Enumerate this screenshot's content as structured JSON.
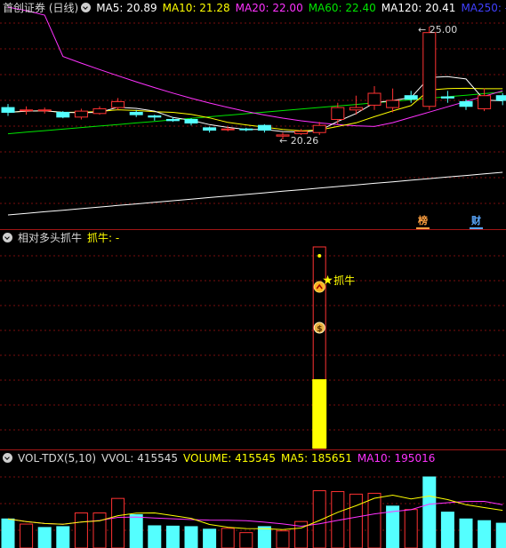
{
  "colors": {
    "up": "#ff3232",
    "down": "#54ffff",
    "ma5": "#ffffff",
    "ma10": "#ffff00",
    "ma20": "#ff32ff",
    "ma60": "#00e600",
    "ma120": "#ffffff",
    "ma250": "#4040ff",
    "grid": "#7a0e0e",
    "label": "#d8d8d8",
    "yellow": "#ffff00",
    "cyan": "#54ffff"
  },
  "main": {
    "title": "首创证券 (日线)",
    "ma": [
      {
        "label": "MA5: 20.89",
        "color": "#ffffff"
      },
      {
        "label": "MA10: 21.28",
        "color": "#ffff00"
      },
      {
        "label": "MA20: 22.00",
        "color": "#ff32ff"
      },
      {
        "label": "MA60: 22.40",
        "color": "#00e600"
      },
      {
        "label": "MA120: 20.41",
        "color": "#ffffff"
      },
      {
        "label": "MA250: -",
        "color": "#4040ff"
      }
    ],
    "high_label": "25.00",
    "low_label": "20.26",
    "tags": [
      {
        "text": "榜",
        "color": "#ffa040"
      },
      {
        "text": "财",
        "color": "#5aa8ff"
      }
    ]
  },
  "indicator": {
    "title": "相对多头抓牛",
    "signal_label": "抓牛: -",
    "star_label": "抓牛"
  },
  "volume": {
    "title": "VOL-TDX(5,10)",
    "vvol": "VVOL: 415545",
    "volume": "VOLUME: 415545",
    "ma5": "MA5: 185651",
    "ma10": "MA10: 195016"
  },
  "chart_data": {
    "type": "candlestick",
    "candles": [
      {
        "o": 21.6,
        "c": 21.4,
        "h": 21.75,
        "l": 21.25,
        "up": false
      },
      {
        "o": 21.5,
        "c": 21.5,
        "h": 21.65,
        "l": 21.3,
        "up": true
      },
      {
        "o": 21.5,
        "c": 21.5,
        "h": 21.6,
        "l": 21.35,
        "up": true
      },
      {
        "o": 21.4,
        "c": 21.2,
        "h": 21.45,
        "l": 21.15,
        "up": false
      },
      {
        "o": 21.2,
        "c": 21.45,
        "h": 21.55,
        "l": 21.1,
        "up": true
      },
      {
        "o": 21.35,
        "c": 21.55,
        "h": 21.65,
        "l": 21.3,
        "up": true
      },
      {
        "o": 21.6,
        "c": 21.85,
        "h": 22.0,
        "l": 21.5,
        "up": true
      },
      {
        "o": 21.4,
        "c": 21.3,
        "h": 21.5,
        "l": 21.2,
        "up": false
      },
      {
        "o": 21.25,
        "c": 21.2,
        "h": 21.3,
        "l": 21.05,
        "up": false
      },
      {
        "o": 21.1,
        "c": 21.05,
        "h": 21.2,
        "l": 21.0,
        "up": false
      },
      {
        "o": 21.1,
        "c": 20.95,
        "h": 21.15,
        "l": 20.85,
        "up": false
      },
      {
        "o": 20.75,
        "c": 20.65,
        "h": 20.8,
        "l": 20.55,
        "up": false
      },
      {
        "o": 20.7,
        "c": 20.7,
        "h": 20.8,
        "l": 20.6,
        "up": true
      },
      {
        "o": 20.7,
        "c": 20.68,
        "h": 20.75,
        "l": 20.6,
        "up": false
      },
      {
        "o": 20.85,
        "c": 20.65,
        "h": 20.9,
        "l": 20.55,
        "up": false
      },
      {
        "o": 20.4,
        "c": 20.45,
        "h": 20.55,
        "l": 20.26,
        "up": true
      },
      {
        "o": 20.5,
        "c": 20.6,
        "h": 20.7,
        "l": 20.45,
        "up": true
      },
      {
        "o": 20.55,
        "c": 20.85,
        "h": 21.0,
        "l": 20.45,
        "up": true
      },
      {
        "o": 21.1,
        "c": 21.6,
        "h": 21.8,
        "l": 20.9,
        "up": true
      },
      {
        "o": 21.5,
        "c": 21.6,
        "h": 22.1,
        "l": 21.3,
        "up": true
      },
      {
        "o": 21.7,
        "c": 22.2,
        "h": 22.5,
        "l": 21.5,
        "up": true
      },
      {
        "o": 21.6,
        "c": 21.9,
        "h": 22.4,
        "l": 21.4,
        "up": true
      },
      {
        "o": 22.1,
        "c": 21.95,
        "h": 22.3,
        "l": 21.8,
        "up": false
      },
      {
        "o": 21.65,
        "c": 24.75,
        "h": 25.0,
        "l": 21.5,
        "up": true
      },
      {
        "o": 22.05,
        "c": 22.0,
        "h": 22.3,
        "l": 21.8,
        "up": false
      },
      {
        "o": 21.85,
        "c": 21.65,
        "h": 21.95,
        "l": 21.5,
        "up": false
      },
      {
        "o": 21.55,
        "c": 22.1,
        "h": 22.4,
        "l": 21.45,
        "up": true
      },
      {
        "o": 22.1,
        "c": 21.9,
        "h": 22.2,
        "l": 21.7,
        "up": false
      }
    ],
    "volumes": [
      {
        "v": 170000,
        "up": false
      },
      {
        "v": 140000,
        "up": true
      },
      {
        "v": 120000,
        "up": false
      },
      {
        "v": 125000,
        "up": false
      },
      {
        "v": 205000,
        "up": true
      },
      {
        "v": 205000,
        "up": true
      },
      {
        "v": 290000,
        "up": true
      },
      {
        "v": 195000,
        "up": false
      },
      {
        "v": 130000,
        "up": false
      },
      {
        "v": 128000,
        "up": false
      },
      {
        "v": 125000,
        "up": false
      },
      {
        "v": 110000,
        "up": false
      },
      {
        "v": 115000,
        "up": true
      },
      {
        "v": 90000,
        "up": true
      },
      {
        "v": 125000,
        "up": false
      },
      {
        "v": 100000,
        "up": true
      },
      {
        "v": 155000,
        "up": true
      },
      {
        "v": 335000,
        "up": true
      },
      {
        "v": 330000,
        "up": true
      },
      {
        "v": 315000,
        "up": true
      },
      {
        "v": 320000,
        "up": true
      },
      {
        "v": 245000,
        "up": false
      },
      {
        "v": 225000,
        "up": true
      },
      {
        "v": 415545,
        "up": false
      },
      {
        "v": 210000,
        "up": false
      },
      {
        "v": 170000,
        "up": false
      },
      {
        "v": 160000,
        "up": false
      },
      {
        "v": 145000,
        "up": false
      }
    ]
  }
}
